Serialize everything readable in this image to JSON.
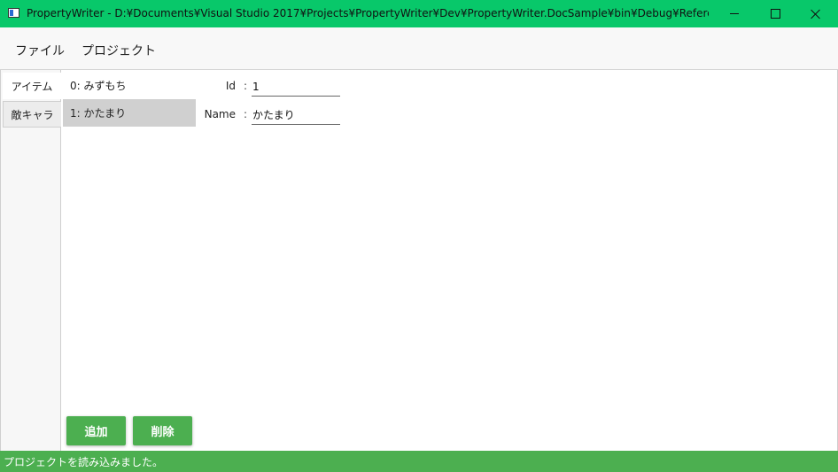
{
  "window": {
    "title": "PropertyWriter - D:¥Documents¥Visual Studio 2017¥Projects¥PropertyWriter¥Dev¥PropertyWriter.DocSample¥bin¥Debug¥ReferenceMember.pwp...",
    "icon": "app-icon",
    "accent_color": "#08c86a"
  },
  "menu": {
    "items": [
      "ファイル",
      "プロジェクト"
    ]
  },
  "tabs": [
    {
      "label": "アイテム",
      "selected": false
    },
    {
      "label": "敵キャラ",
      "selected": true
    }
  ],
  "list": {
    "items": [
      {
        "label": "0: みずもち",
        "selected": false
      },
      {
        "label": "1: かたまり",
        "selected": true
      }
    ]
  },
  "fields": [
    {
      "label": "Id",
      "colon": ":",
      "value": "1"
    },
    {
      "label": "Name",
      "colon": ":",
      "value": "かたまり"
    }
  ],
  "buttons": {
    "add": "追加",
    "delete": "削除",
    "color": "#4caf50"
  },
  "status": {
    "text": "プロジェクトを読み込みました。",
    "color": "#4caf50"
  }
}
